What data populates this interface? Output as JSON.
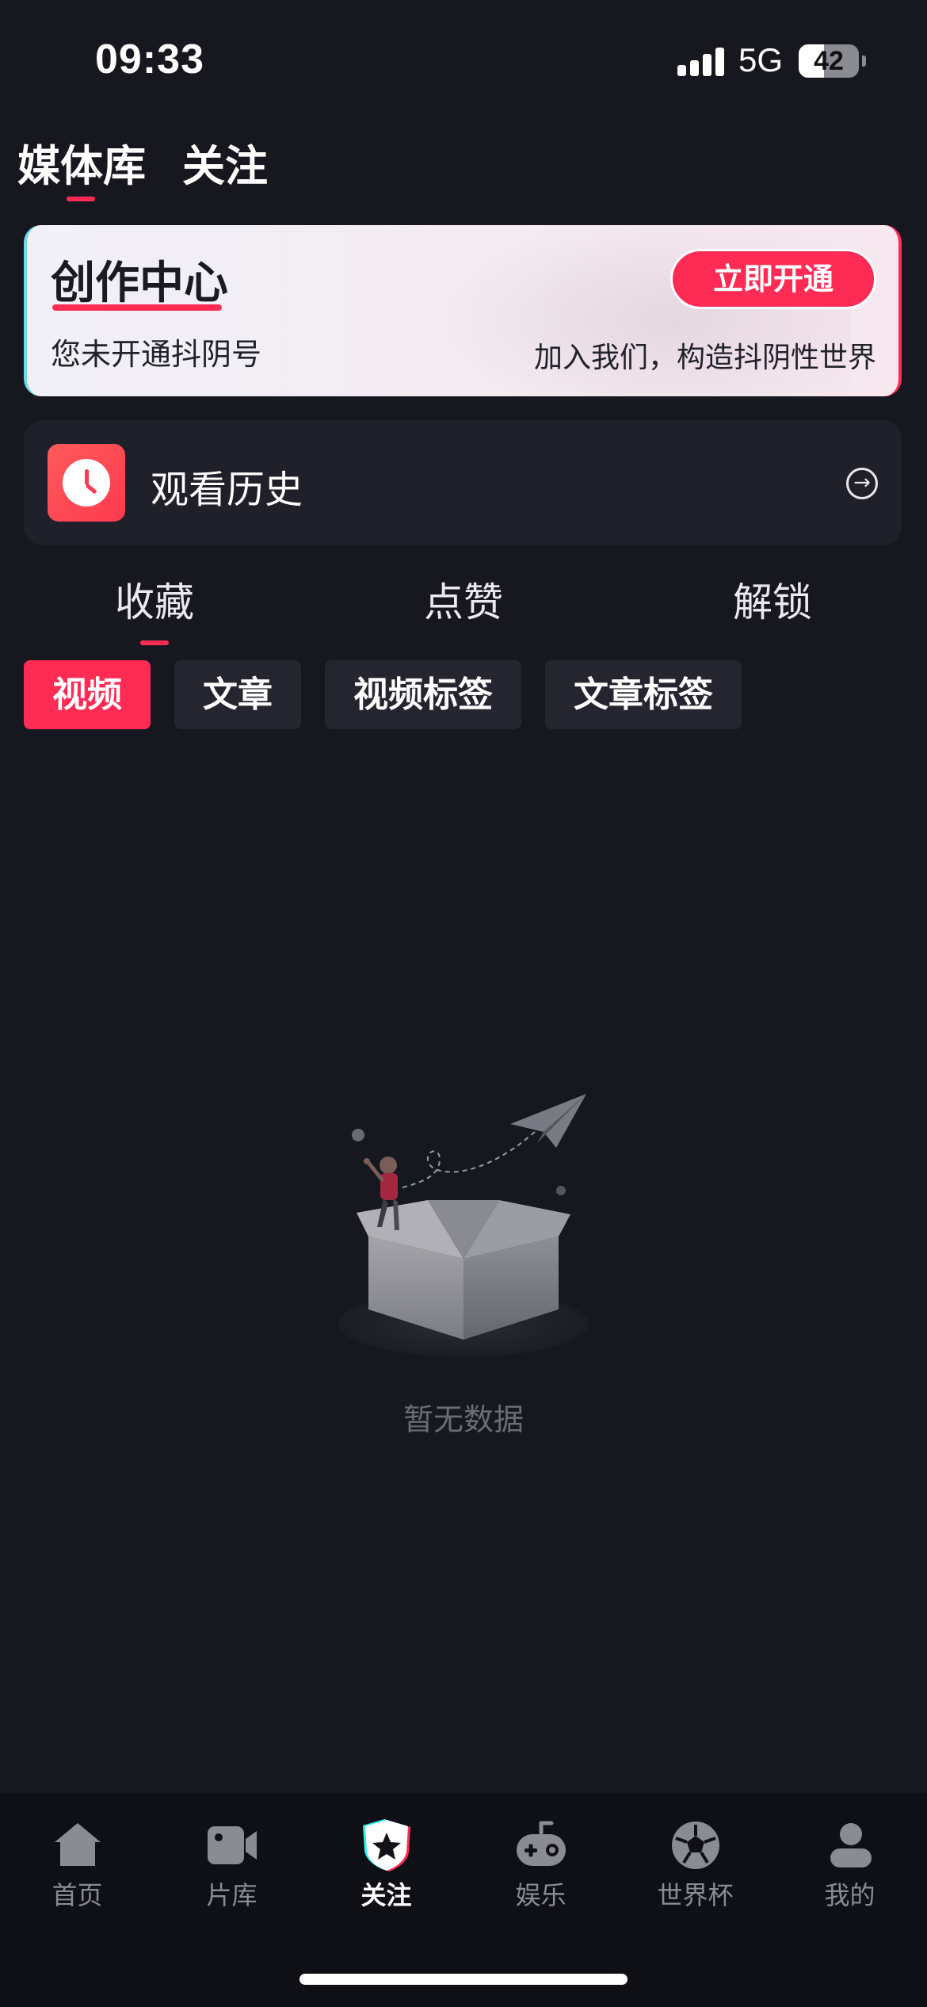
{
  "status_bar": {
    "time": "09:33",
    "network": "5G",
    "battery": "42",
    "battery_level": 0.42
  },
  "top_tabs": [
    {
      "label": "媒体库",
      "active": true
    },
    {
      "label": "关注",
      "active": false
    }
  ],
  "banner": {
    "title": "创作中心",
    "subtitle": "您未开通抖阴号",
    "button_label": "立即开通",
    "tagline": "加入我们，构造抖阴性世界"
  },
  "history": {
    "label": "观看历史",
    "icon": "clock-icon"
  },
  "section_tabs": [
    {
      "label": "收藏",
      "active": true
    },
    {
      "label": "点赞",
      "active": false
    },
    {
      "label": "解锁",
      "active": false
    }
  ],
  "chips": [
    {
      "label": "视频",
      "active": true
    },
    {
      "label": "文章",
      "active": false
    },
    {
      "label": "视频标签",
      "active": false
    },
    {
      "label": "文章标签",
      "active": false
    }
  ],
  "empty_state": {
    "text": "暂无数据",
    "illustration": "empty-box-illustration"
  },
  "bottom_nav": [
    {
      "label": "首页",
      "icon": "home-icon",
      "active": false
    },
    {
      "label": "片库",
      "icon": "video-camera-icon",
      "active": false
    },
    {
      "label": "关注",
      "icon": "star-shield-icon",
      "active": true
    },
    {
      "label": "娱乐",
      "icon": "gamepad-icon",
      "active": false
    },
    {
      "label": "世界杯",
      "icon": "soccer-ball-icon",
      "active": false
    },
    {
      "label": "我的",
      "icon": "user-icon",
      "active": false
    }
  ],
  "colors": {
    "accent": "#fe2c55",
    "background": "#17171f",
    "card": "#20202a",
    "nav_bg": "#0f0f16",
    "muted": "#8b8b94"
  }
}
